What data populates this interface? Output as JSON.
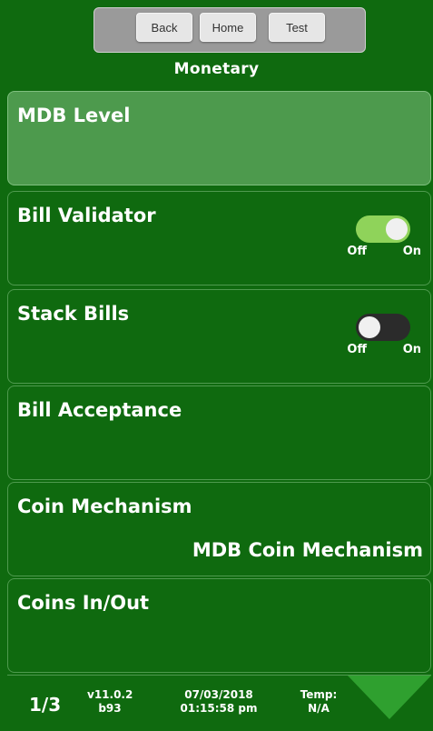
{
  "header": {
    "back_label": "Back",
    "home_label": "Home",
    "test_label": "Test",
    "title": "Monetary"
  },
  "items": [
    {
      "label": "MDB Level",
      "selected": true
    },
    {
      "label": "Bill Validator",
      "toggle": "on",
      "off_label": "Off",
      "on_label": "On"
    },
    {
      "label": "Stack Bills",
      "toggle": "off",
      "off_label": "Off",
      "on_label": "On"
    },
    {
      "label": "Bill Acceptance"
    },
    {
      "label": "Coin Mechanism",
      "value": "MDB Coin Mechanism"
    },
    {
      "label": "Coins In/Out"
    }
  ],
  "footer": {
    "page": "1/3",
    "version_line1": "v11.0.2",
    "version_line2": "b93",
    "date": "07/03/2018",
    "time": "01:15:58 pm",
    "temp_label": "Temp:",
    "temp_value": "N/A"
  },
  "colors": {
    "background": "#0f6a0f",
    "selected_row": "#4d9a4d",
    "toggle_on": "#8fd35a",
    "toggle_off": "#2b2b2b",
    "arrow": "#2fa02f"
  },
  "icons": {
    "next_page": "chevron-down-icon"
  }
}
